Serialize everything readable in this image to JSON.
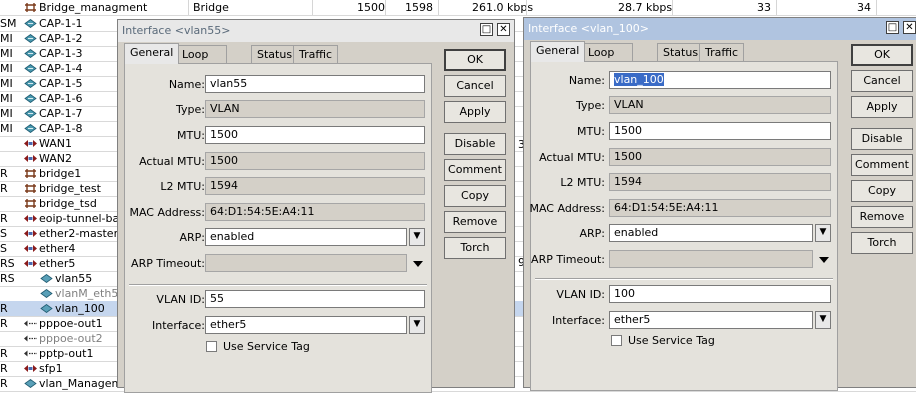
{
  "list": {
    "header": {
      "flag": "",
      "name": "Bridge_managment",
      "type": "Bridge",
      "mtu": "1500",
      "l2mtu": "1598",
      "tx": "261.0 kbps",
      "rx": "28.7 kbps",
      "tx_packets": "33",
      "rx_packets": "34"
    },
    "rows": [
      {
        "flag": "SM",
        "name": "CAP-1-1",
        "icon": "cap-icon"
      },
      {
        "flag": "MI",
        "name": "CAP-1-2",
        "icon": "cap-icon"
      },
      {
        "flag": "MI",
        "name": "CAP-1-3",
        "icon": "cap-icon"
      },
      {
        "flag": "MI",
        "name": "CAP-1-4",
        "icon": "cap-icon"
      },
      {
        "flag": "MI",
        "name": "CAP-1-5",
        "icon": "cap-icon"
      },
      {
        "flag": "MI",
        "name": "CAP-1-6",
        "icon": "cap-icon"
      },
      {
        "flag": "MI",
        "name": "CAP-1-7",
        "icon": "cap-icon"
      },
      {
        "flag": "MI",
        "name": "CAP-1-8",
        "icon": "cap-icon"
      },
      {
        "flag": "",
        "name": "WAN1",
        "icon": "ethernet-icon"
      },
      {
        "flag": "",
        "name": "WAN2",
        "icon": "ethernet-icon"
      },
      {
        "flag": "R",
        "name": "bridge1",
        "icon": "bridge-icon"
      },
      {
        "flag": "R",
        "name": "bridge_test",
        "icon": "bridge-icon"
      },
      {
        "flag": "",
        "name": "bridge_tsd",
        "icon": "bridge-icon"
      },
      {
        "flag": "R",
        "name": "eoip-tunnel-barr",
        "icon": "ethernet-icon"
      },
      {
        "flag": "S",
        "name": "ether2-master",
        "icon": "ethernet-icon"
      },
      {
        "flag": "S",
        "name": "ether4",
        "icon": "ethernet-icon"
      },
      {
        "flag": "RS",
        "name": "ether5",
        "icon": "ethernet-icon"
      },
      {
        "flag": "RS",
        "name": "vlan55",
        "icon": "vlan-icon",
        "indent": true
      },
      {
        "flag": "",
        "name": "vlanM_eth5",
        "icon": "vlan-icon",
        "indent": true,
        "dim": true
      },
      {
        "flag": "R",
        "name": "vlan_100",
        "icon": "vlan-icon",
        "indent": true,
        "selected": true
      },
      {
        "flag": "R",
        "name": "pppoe-out1",
        "icon": "pppoe-icon"
      },
      {
        "flag": "",
        "name": "pppoe-out2",
        "icon": "pppoe-icon",
        "dim": true
      },
      {
        "flag": "R",
        "name": "pptp-out1",
        "icon": "pptp-icon"
      },
      {
        "flag": "R",
        "name": "sfp1",
        "icon": "ethernet-icon"
      },
      {
        "flag": "R",
        "name": "vlan_Manageme",
        "icon": "vlan-icon"
      }
    ],
    "side_marks": {
      "row9": "3",
      "row17": "9"
    }
  },
  "windows": [
    {
      "id": "vlan55",
      "title": "Interface <vlan55>",
      "active": false,
      "tabs": [
        "General",
        "Loop Protect",
        "Status",
        "Traffic"
      ],
      "active_tab": "General",
      "fields": {
        "name_label": "Name:",
        "name": "vlan55",
        "type_label": "Type:",
        "type": "VLAN",
        "mtu_label": "MTU:",
        "mtu": "1500",
        "actual_mtu_label": "Actual MTU:",
        "actual_mtu": "1500",
        "l2mtu_label": "L2 MTU:",
        "l2mtu": "1594",
        "mac_label": "MAC Address:",
        "mac": "64:D1:54:5E:A4:11",
        "arp_label": "ARP:",
        "arp": "enabled",
        "arp_timeout_label": "ARP Timeout:",
        "arp_timeout": "",
        "vlan_id_label": "VLAN ID:",
        "vlan_id": "55",
        "interface_label": "Interface:",
        "interface": "ether5",
        "service_tag_label": "Use Service Tag"
      },
      "buttons": [
        "OK",
        "Cancel",
        "Apply",
        "Disable",
        "Comment",
        "Copy",
        "Remove",
        "Torch"
      ]
    },
    {
      "id": "vlan_100",
      "title": "Interface <vlan_100>",
      "active": true,
      "tabs": [
        "General",
        "Loop Protect",
        "Status",
        "Traffic"
      ],
      "active_tab": "General",
      "fields": {
        "name_label": "Name:",
        "name": "vlan_100",
        "type_label": "Type:",
        "type": "VLAN",
        "mtu_label": "MTU:",
        "mtu": "1500",
        "actual_mtu_label": "Actual MTU:",
        "actual_mtu": "1500",
        "l2mtu_label": "L2 MTU:",
        "l2mtu": "1594",
        "mac_label": "MAC Address:",
        "mac": "64:D1:54:5E:A4:11",
        "arp_label": "ARP:",
        "arp": "enabled",
        "arp_timeout_label": "ARP Timeout:",
        "arp_timeout": "",
        "vlan_id_label": "VLAN ID:",
        "vlan_id": "100",
        "interface_label": "Interface:",
        "interface": "ether5",
        "service_tag_label": "Use Service Tag"
      },
      "buttons": [
        "OK",
        "Cancel",
        "Apply",
        "Disable",
        "Comment",
        "Copy",
        "Remove",
        "Torch"
      ]
    }
  ],
  "window_controls": {
    "maximize": "□",
    "close": "✕",
    "dropdown": "▼"
  },
  "colors": {
    "selection": "#c5d6ee",
    "active_title": "#b0c4e0",
    "text_selection": "#3a6bc6"
  }
}
